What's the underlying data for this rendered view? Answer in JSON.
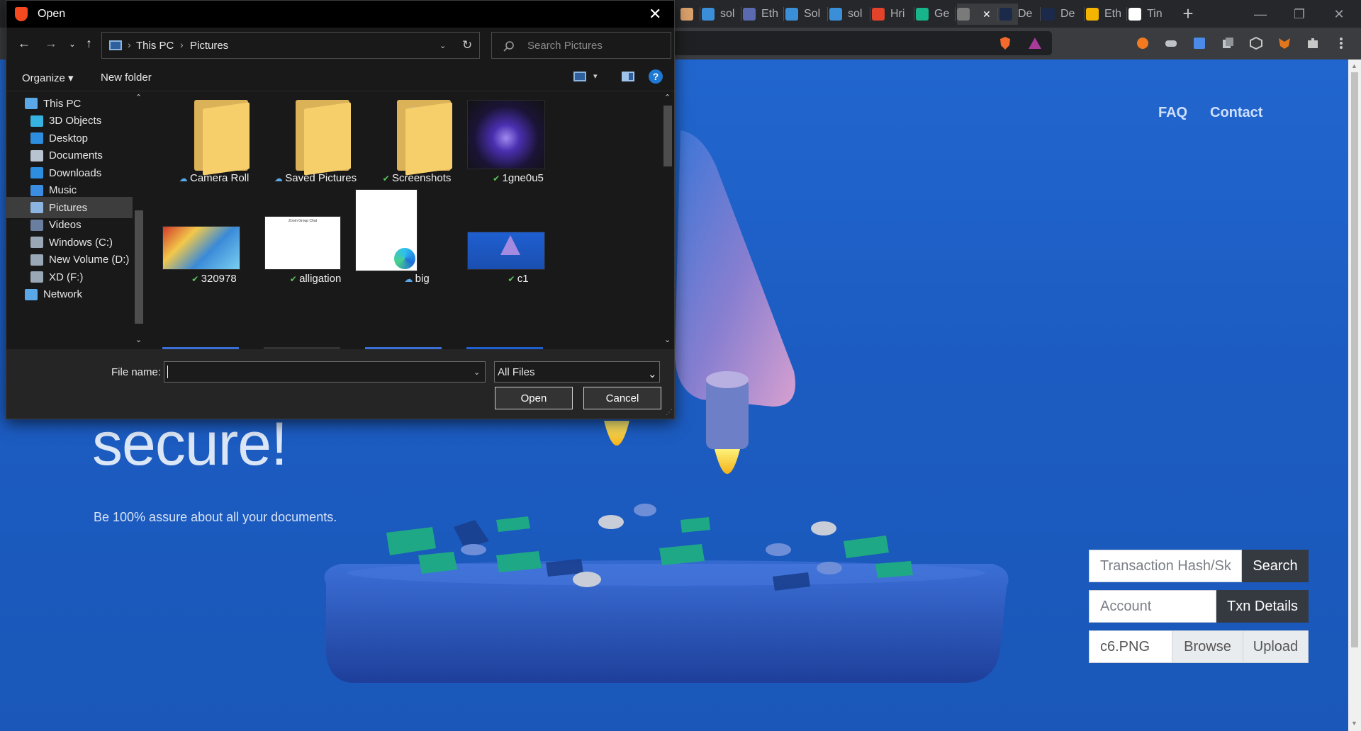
{
  "browser": {
    "tabs": [
      {
        "label": "",
        "icon": "document-icon",
        "color": "#d9a16b"
      },
      {
        "label": "sol",
        "icon": "eth-icon",
        "color": "#3b8fd9"
      },
      {
        "label": "Eth",
        "icon": "globe-icon",
        "color": "#5a6ab0"
      },
      {
        "label": "Sol",
        "icon": "eth-icon",
        "color": "#3b8fd9"
      },
      {
        "label": "sol",
        "icon": "eth-icon",
        "color": "#3b8fd9"
      },
      {
        "label": "Hri",
        "icon": "gitlab-icon",
        "color": "#e2432a"
      },
      {
        "label": "Ge",
        "icon": "diamond-icon",
        "color": "#19b58a"
      },
      {
        "label": "",
        "icon": "globe-icon",
        "color": "#7a7a7a"
      },
      {
        "label": "De",
        "icon": "d-icon",
        "color": "#1b2a4a"
      },
      {
        "label": "De",
        "icon": "d-icon",
        "color": "#1b2a4a"
      },
      {
        "label": "Eth",
        "icon": "drive-icon",
        "color": "#f4b400"
      },
      {
        "label": "Tin",
        "icon": "check-icon",
        "color": "#ffffff"
      }
    ],
    "new_tab": "+",
    "win_minimize": "—",
    "win_restore": "❐",
    "win_close": "✕"
  },
  "site": {
    "nav": {
      "faq": "FAQ",
      "contact": "Contact"
    },
    "hero_word": "secure!",
    "hero_sub": "Be 100% assure about all your documents.",
    "form": {
      "hash_placeholder": "Transaction Hash/Sk",
      "search_btn": "Search",
      "account_placeholder": "Account",
      "txn_btn": "Txn Details",
      "file_value": "c6.PNG",
      "browse_btn": "Browse",
      "upload_btn": "Upload"
    }
  },
  "dialog": {
    "title": "Open",
    "breadcrumb": [
      "This PC",
      "Pictures"
    ],
    "search_placeholder": "Search Pictures",
    "organize": "Organize ▾",
    "new_folder": "New folder",
    "help": "?",
    "tree": [
      {
        "label": "This PC",
        "icon": "computer-icon",
        "color": "#5aa8e8",
        "indent": 1
      },
      {
        "label": "3D Objects",
        "icon": "cube-icon",
        "color": "#36b3e0",
        "indent": 2
      },
      {
        "label": "Desktop",
        "icon": "desktop-icon",
        "color": "#2d8ee0",
        "indent": 2
      },
      {
        "label": "Documents",
        "icon": "document-icon",
        "color": "#b8c4d0",
        "indent": 2
      },
      {
        "label": "Downloads",
        "icon": "download-icon",
        "color": "#2d8ee0",
        "indent": 2
      },
      {
        "label": "Music",
        "icon": "music-icon",
        "color": "#3a8de0",
        "indent": 2
      },
      {
        "label": "Pictures",
        "icon": "pictures-icon",
        "color": "#8bb4e0",
        "indent": 2,
        "selected": true
      },
      {
        "label": "Videos",
        "icon": "videos-icon",
        "color": "#6a7ea0",
        "indent": 2
      },
      {
        "label": "Windows (C:)",
        "icon": "drive-icon",
        "color": "#9aa8b6",
        "indent": 2
      },
      {
        "label": "New Volume (D:)",
        "icon": "drive-icon",
        "color": "#9aa8b6",
        "indent": 2
      },
      {
        "label": "XD (F:)",
        "icon": "drive-icon",
        "color": "#9aa8b6",
        "indent": 2
      },
      {
        "label": "Network",
        "icon": "network-icon",
        "color": "#5aa8e8",
        "indent": 1
      }
    ],
    "files": [
      {
        "name": "Camera Roll",
        "type": "folder",
        "status": "cloud"
      },
      {
        "name": "Saved Pictures",
        "type": "folder",
        "status": "cloud"
      },
      {
        "name": "Screenshots",
        "type": "folder-filled",
        "status": "synced"
      },
      {
        "name": "1gne0u5",
        "type": "image",
        "status": "synced"
      },
      {
        "name": "320978",
        "type": "image",
        "status": "synced"
      },
      {
        "name": "alligation",
        "type": "image",
        "status": "synced"
      },
      {
        "name": "big",
        "type": "image",
        "status": "cloud"
      },
      {
        "name": "c1",
        "type": "image",
        "status": "synced"
      }
    ],
    "file_name_label": "File name:",
    "file_name_value": "",
    "filter": "All Files",
    "open_btn": "Open",
    "cancel_btn": "Cancel",
    "alligation_thumb_title": "Zoom Group Chat"
  },
  "colors": {
    "accent": "#2166ce",
    "folder": "#f6cf6b",
    "synced": "#5cc45c",
    "cloud": "#5aa8e8"
  }
}
